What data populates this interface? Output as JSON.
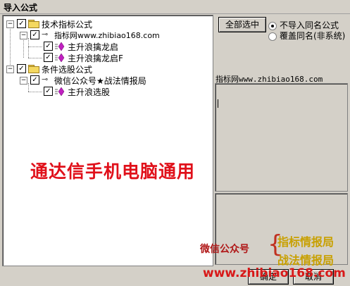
{
  "window": {
    "title": "导入公式"
  },
  "tree": {
    "groups": [
      {
        "label": "技术指标公式",
        "checked": true,
        "sub": {
          "label": "指标网www.zhibiao168.com",
          "checked": true,
          "items": [
            {
              "label": "主升浪擒龙启",
              "checked": true
            },
            {
              "label": "主升浪擒龙启F",
              "checked": true
            }
          ]
        }
      },
      {
        "label": "条件选股公式",
        "checked": true,
        "sub": {
          "label": "微信公众号★战法情报局",
          "checked": true,
          "items": [
            {
              "label": "主升浪选股",
              "checked": true
            }
          ]
        }
      }
    ]
  },
  "buttons": {
    "select_all": "全部选中",
    "ok": "确定",
    "cancel": "取消"
  },
  "options": [
    {
      "label": "不导入同名公式",
      "selected": true
    },
    {
      "label": "覆盖同名(非系统)",
      "selected": false
    }
  ],
  "info": {
    "author": "指标网www.zhibiao168.com"
  },
  "overlay": {
    "promo": "通达信手机电脑通用",
    "wechat": "微信公众号",
    "tag1": "指标情报局",
    "tag2": "战法情报局",
    "url": "www.zhibiao168.com"
  },
  "colors": {
    "promo": "#e0101a",
    "tag": "#c8a000",
    "url": "#d81818"
  }
}
